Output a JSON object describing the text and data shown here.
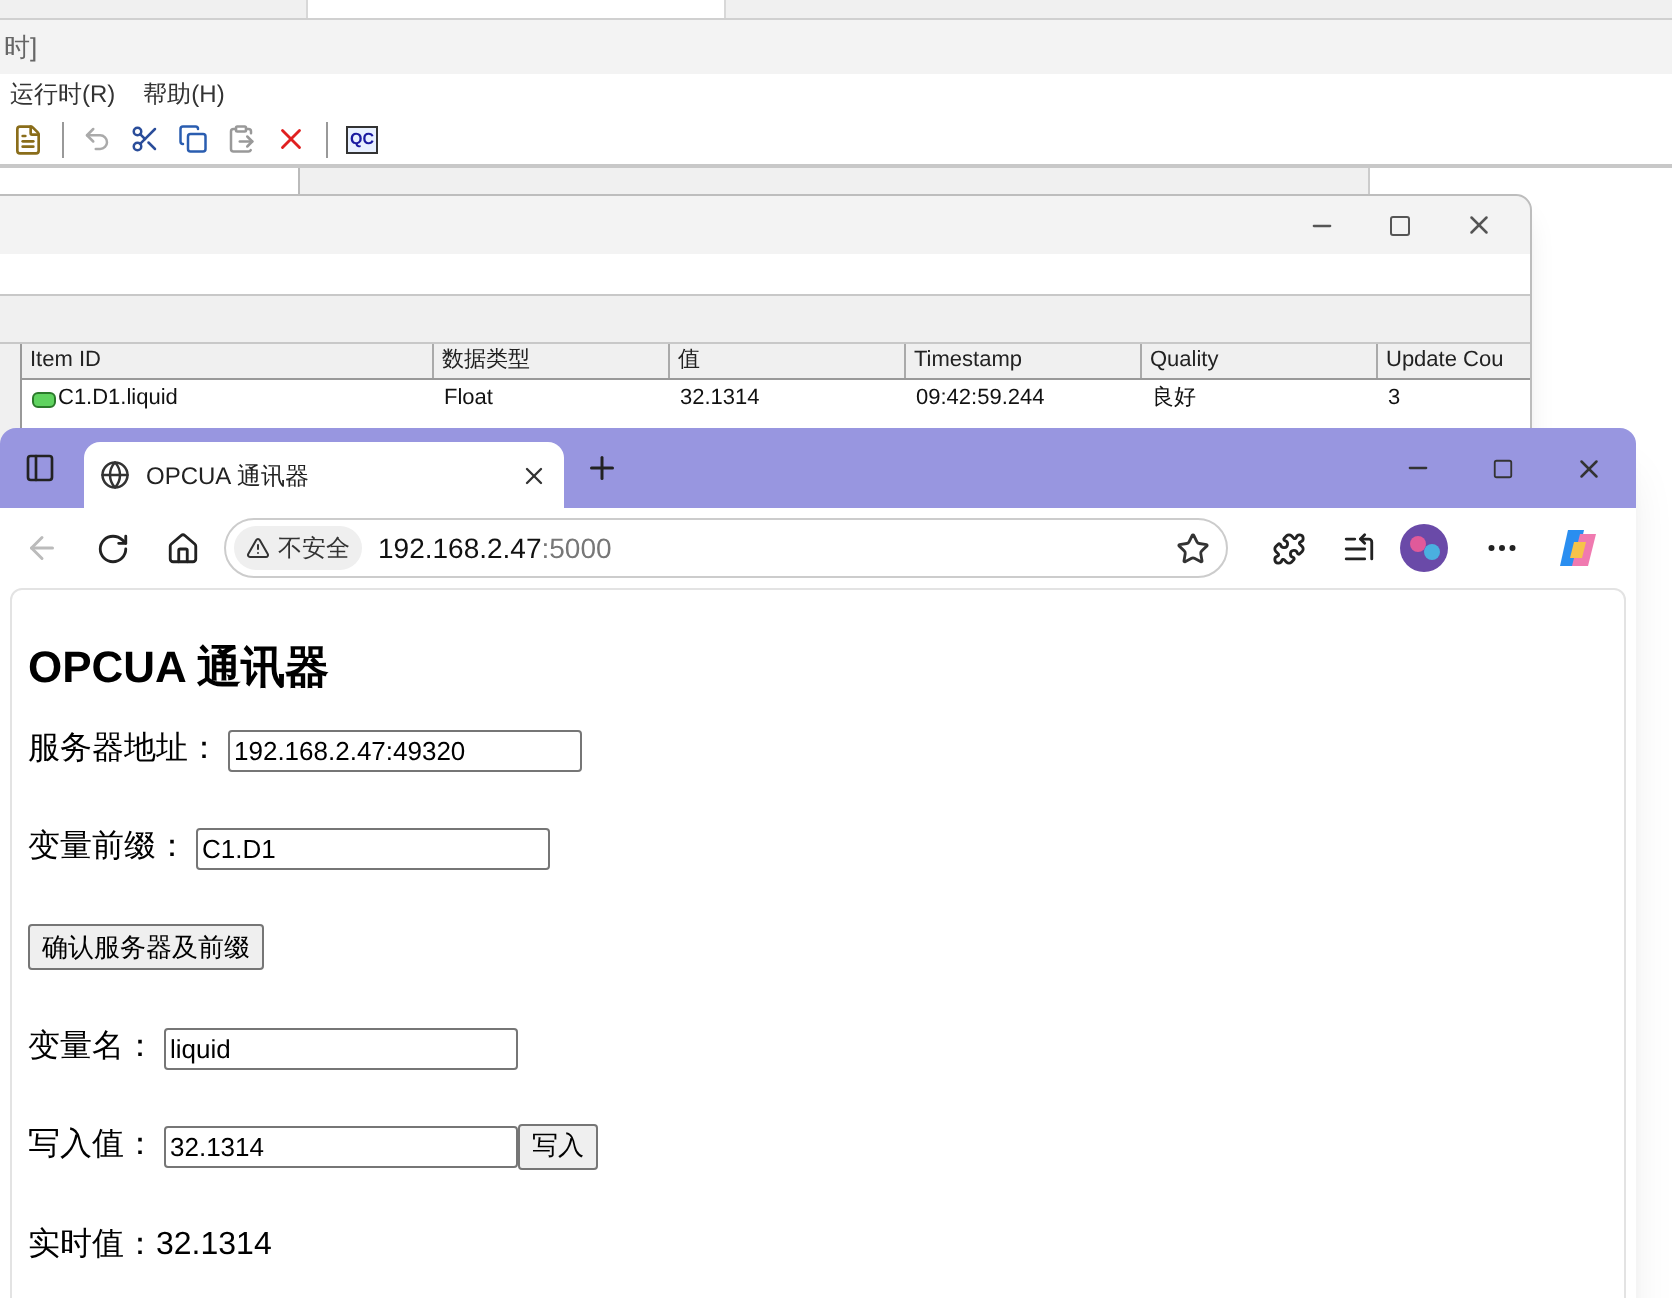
{
  "back_window": {
    "title_fragment": "时]",
    "menu": [
      "运行时(R)",
      "帮助(H)"
    ],
    "toolbar_badge": "QC"
  },
  "quick_client": {
    "columns": [
      "Item ID",
      "数据类型",
      "值",
      "Timestamp",
      "Quality",
      "Update Cou"
    ],
    "rows": [
      {
        "cells": [
          "C1.D1.liquid",
          "Float",
          "32.1314",
          "09:42:59.244",
          "良好",
          "3"
        ]
      }
    ]
  },
  "browser": {
    "tab_title": "OPCUA 通讯器",
    "security_label": "不安全",
    "url_host": "192.168.2.47",
    "url_port": ":5000"
  },
  "page": {
    "items": [
      {
        "kind": "heading",
        "text": "OPCUA 通讯器"
      },
      {
        "kind": "field",
        "label": "服务器地址：",
        "value": "192.168.2.47:49320"
      },
      {
        "kind": "field",
        "label": "变量前缀：",
        "value": "C1.D1"
      },
      {
        "kind": "button",
        "text": "确认服务器及前缀"
      },
      {
        "kind": "field",
        "label": "变量名：",
        "value": "liquid"
      },
      {
        "kind": "field",
        "label": "写入值：",
        "value": "32.1314",
        "button": "写入"
      },
      {
        "kind": "readout",
        "text": "实时值：32.1314"
      }
    ]
  }
}
